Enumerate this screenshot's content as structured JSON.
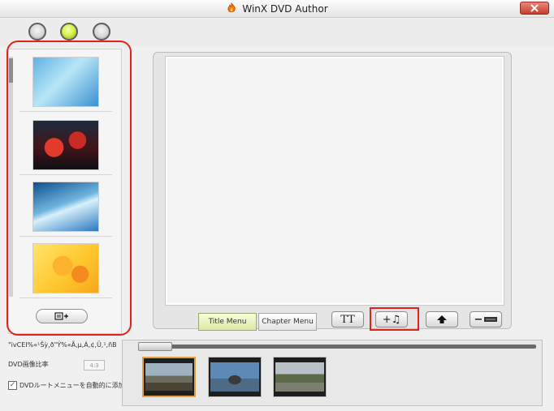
{
  "window": {
    "title": "WinX DVD Author",
    "close_icon": "close-icon"
  },
  "header": {
    "steps": [
      {
        "icon": "step-1-radio-icon",
        "active": false
      },
      {
        "icon": "step-2-radio-icon",
        "active": true
      },
      {
        "icon": "step-3-radio-icon",
        "active": false
      }
    ]
  },
  "templates": {
    "items": [
      {
        "icon": "blue-bubbles-template"
      },
      {
        "icon": "red-flowers-template"
      },
      {
        "icon": "blue-swirl-template"
      },
      {
        "icon": "yellow-flowers-template"
      }
    ],
    "add_button_icon": "add-template-icon"
  },
  "preview": {
    "tabs": [
      {
        "label": "Title Menu",
        "active": true
      },
      {
        "label": "Chapter Menu",
        "active": false
      }
    ],
    "tools": {
      "text_label": "TT",
      "music_label": "+♫",
      "upload_icon": "up-arrow-icon",
      "remove_label": "−"
    }
  },
  "options": {
    "garbled_text": "\"ivCEI%«¹Šỳ,ð\"Ý%«Ã,µ,Á,¢,Ü,¹,ñB",
    "aspect_label": "DVD画像比率",
    "aspect_value": "4:3",
    "checkbox_label": "DVDルートメニューを自動的に添加する",
    "checkbox_checked": true
  },
  "chapters": {
    "slider_icon": "slider-handle-icon",
    "clips": [
      {
        "icon": "seaside-clip",
        "selected": true
      },
      {
        "icon": "stacked-stones-clip",
        "selected": false
      },
      {
        "icon": "tree-path-clip",
        "selected": false
      }
    ]
  },
  "colors": {
    "highlight_red": "#e0231c",
    "active_green": "#d7f14b",
    "selected_orange": "#e4a23b"
  }
}
